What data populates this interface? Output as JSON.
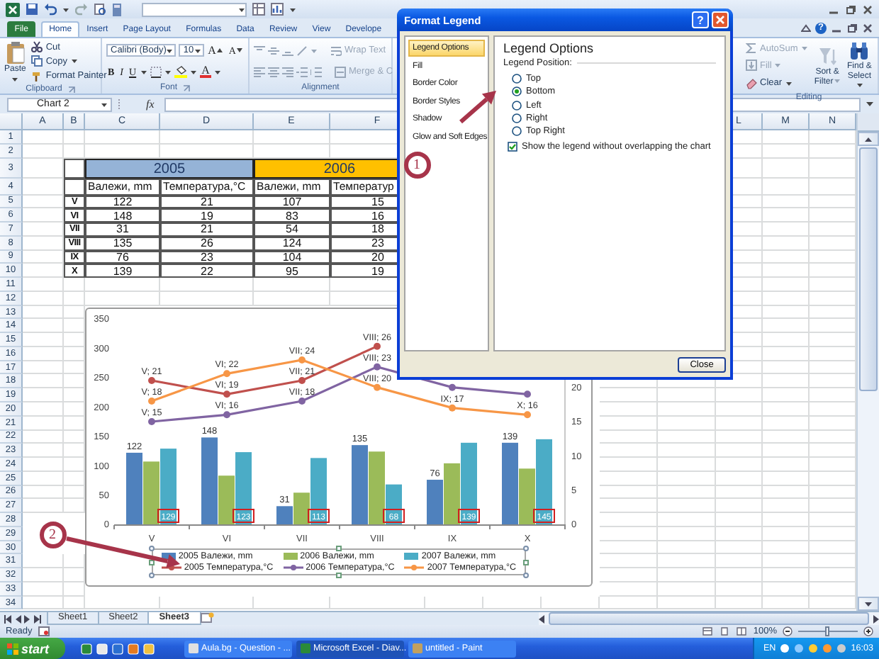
{
  "ribbon_tabs": [
    {
      "label": "File",
      "kind": "file",
      "selected": false
    },
    {
      "label": "Home",
      "kind": "tab",
      "selected": true
    },
    {
      "label": "Insert",
      "kind": "tab",
      "selected": false
    },
    {
      "label": "Page Layout",
      "kind": "tab",
      "selected": false
    },
    {
      "label": "Formulas",
      "kind": "tab",
      "selected": false
    },
    {
      "label": "Data",
      "kind": "tab",
      "selected": false
    },
    {
      "label": "Review",
      "kind": "tab",
      "selected": false
    },
    {
      "label": "View",
      "kind": "tab",
      "selected": false
    },
    {
      "label": "Develope",
      "kind": "tab",
      "selected": false
    }
  ],
  "ribbon": {
    "help_button": "?",
    "clipboard": {
      "paste": "Paste",
      "cut": "Cut",
      "copy": "Copy",
      "format_painter": "Format Painter",
      "label": "Clipboard"
    },
    "font": {
      "font_name": "Calibri (Body)",
      "font_size": "10",
      "size_buttons": [
        "A",
        "A"
      ],
      "style_buttons": [
        "B",
        "I",
        "U"
      ],
      "color_button": "A",
      "label": "Font"
    },
    "alignment": {
      "buttons": [
        {
          "label": "Wrap Text",
          "kind": "wrap",
          "disabled": true
        },
        {
          "label": "Merge & C",
          "kind": "merge",
          "disabled": true
        }
      ],
      "label": "Alignment"
    },
    "editing": {
      "items": [
        {
          "label": "AutoSum",
          "kind": "autosum",
          "disabled": true
        },
        {
          "label": "Fill",
          "kind": "fill",
          "disabled": true
        },
        {
          "label": "Clear",
          "kind": "clear",
          "disabled": false
        }
      ],
      "large": [
        {
          "label": "Sort & Filter",
          "kind": "sort",
          "disabled": true
        },
        {
          "label": "Find & Select",
          "kind": "find",
          "disabled": false
        }
      ],
      "label": "Editing"
    }
  },
  "formula_bar": {
    "name_box": "Chart 2",
    "function_label": "fx"
  },
  "sheet": {
    "columns_left": [
      "A",
      "B",
      "C",
      "D",
      "E",
      "F"
    ],
    "columns_right": [
      "L",
      "M",
      "N"
    ],
    "rows": [
      "1",
      "2",
      "3",
      "4",
      "5",
      "6",
      "7",
      "8",
      "9",
      "10",
      "11",
      "12",
      "13",
      "14",
      "15",
      "16",
      "17",
      "18",
      "19",
      "20",
      "21",
      "22",
      "23",
      "24",
      "25",
      "26",
      "27",
      "28",
      "29",
      "30",
      "31",
      "32",
      "33",
      "34"
    ]
  },
  "table": {
    "years": [
      {
        "label": "2005",
        "color": "#95b3d7"
      },
      {
        "label": "2006",
        "color": "#ffc000"
      }
    ],
    "headers": [
      "Валежи, mm",
      "Температура,°C",
      "Валежи, mm",
      "Температур"
    ],
    "rows": [
      {
        "month": "V",
        "cells": [
          "122",
          "21",
          "107",
          "15"
        ]
      },
      {
        "month": "VI",
        "cells": [
          "148",
          "19",
          "83",
          "16"
        ]
      },
      {
        "month": "VII",
        "cells": [
          "31",
          "21",
          "54",
          "18"
        ]
      },
      {
        "month": "VIII",
        "cells": [
          "135",
          "26",
          "124",
          "23"
        ]
      },
      {
        "month": "IX",
        "cells": [
          "76",
          "23",
          "104",
          "20"
        ]
      },
      {
        "month": "X",
        "cells": [
          "139",
          "22",
          "95",
          "19"
        ]
      }
    ]
  },
  "chart": {
    "bars": {
      "chart_data": {
        "type": "bar",
        "stacked": false,
        "categories": [
          "V",
          "VI",
          "VII",
          "VIII",
          "IX",
          "X"
        ],
        "ylim": [
          0,
          350
        ],
        "yticks": [
          0,
          50,
          100,
          150,
          200,
          250,
          300,
          350
        ],
        "series": [
          {
            "name": "2005 Валежи, mm",
            "color": "#4f81bd",
            "values": [
              122,
              148,
              31,
              135,
              76,
              139
            ],
            "value_labels": [
              "122",
              "148",
              "31",
              "135",
              "76",
              "139"
            ]
          },
          {
            "name": "2006 Валежи, mm",
            "color": "#9bbb59",
            "values": [
              107,
              83,
              54,
              124,
              104,
              95
            ]
          },
          {
            "name": "2007 Валежи, mm",
            "color": "#4bacc6",
            "values": [
              129,
              123,
              113,
              68,
              139,
              145
            ],
            "value_labels": [
              "129",
              "123",
              "113",
              "68",
              "139",
              "145"
            ]
          }
        ]
      }
    },
    "lines": {
      "chart_data": {
        "type": "line",
        "ylim": [
          0,
          30
        ],
        "yticks": [
          0,
          5,
          10,
          15,
          20
        ],
        "series": [
          {
            "name": "2005 Температура,°C",
            "color": "#c0504d",
            "marker": "circle",
            "values": [
              21,
              19,
              21,
              26,
              null,
              null
            ],
            "value_labels": [
              "V; 21",
              "VI; 19",
              "VII; 21",
              "VIII; 26",
              null,
              null
            ]
          },
          {
            "name": "2006 Температура,°C",
            "color": "#8064a2",
            "marker": "circle",
            "values": [
              15,
              16,
              18,
              23,
              20,
              19
            ],
            "value_labels": [
              "V; 15",
              "VI; 16",
              "VII; 18",
              "VIII; 23",
              null,
              null
            ]
          },
          {
            "name": "2007 Температура,°C",
            "color": "#f79646",
            "marker": "circle",
            "values": [
              18,
              22,
              24,
              20,
              17,
              16
            ],
            "value_labels": [
              "V; 18",
              "VI; 22",
              "VII; 24",
              "VIII; 20",
              "IX; 17",
              "X; 16"
            ]
          }
        ]
      }
    }
  },
  "dialog": {
    "title": "Format Legend",
    "help_button": "?",
    "categories": [
      {
        "label": "Legend Options",
        "selected": true
      },
      {
        "label": "Fill",
        "selected": false
      },
      {
        "label": "Border Color",
        "selected": false
      },
      {
        "label": "Border Styles",
        "selected": false
      },
      {
        "label": "Shadow",
        "selected": false
      },
      {
        "label": "Glow and Soft Edges",
        "selected": false
      }
    ],
    "heading": "Legend Options",
    "position_label": "Legend Position:",
    "positions": [
      {
        "label": "Top",
        "selected": false
      },
      {
        "label": "Bottom",
        "selected": true
      },
      {
        "label": "Left",
        "selected": false
      },
      {
        "label": "Right",
        "selected": false
      },
      {
        "label": "Top Right",
        "selected": false
      }
    ],
    "overlap_checkbox": {
      "label": "Show the legend without overlapping the chart",
      "checked": true
    },
    "close_button": "Close"
  },
  "callouts": [
    "1",
    "2"
  ],
  "sheet_tabs": [
    {
      "label": "Sheet1",
      "selected": false
    },
    {
      "label": "Sheet2",
      "selected": false
    },
    {
      "label": "Sheet3",
      "selected": true
    }
  ],
  "status_bar": {
    "status": "Ready",
    "zoom": "100%",
    "zoom_slider": {
      "level": 0.5
    }
  },
  "taskbar": {
    "start": "start",
    "tasks": [
      {
        "label": "Aula.bg - Question - ...",
        "selected": false
      },
      {
        "label": "Microsoft Excel - Diav...",
        "selected": true
      },
      {
        "label": "untitled - Paint",
        "selected": false
      }
    ],
    "language": "EN",
    "clock": "16:03"
  }
}
